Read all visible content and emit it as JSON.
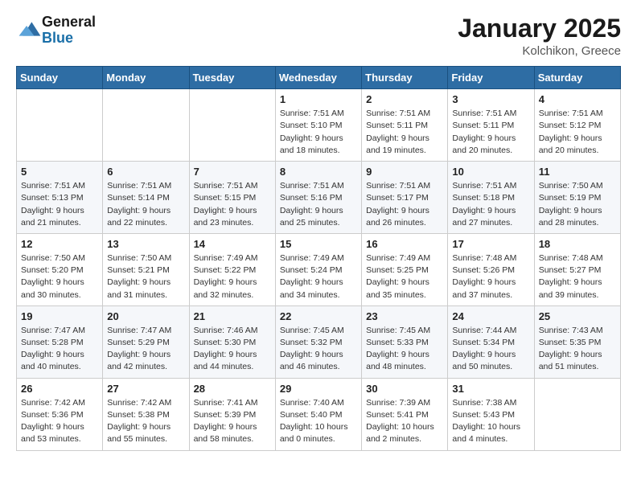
{
  "header": {
    "logo_general": "General",
    "logo_blue": "Blue",
    "month_title": "January 2025",
    "location": "Kolchikon, Greece"
  },
  "weekdays": [
    "Sunday",
    "Monday",
    "Tuesday",
    "Wednesday",
    "Thursday",
    "Friday",
    "Saturday"
  ],
  "weeks": [
    [
      {
        "day": "",
        "info": ""
      },
      {
        "day": "",
        "info": ""
      },
      {
        "day": "",
        "info": ""
      },
      {
        "day": "1",
        "info": "Sunrise: 7:51 AM\nSunset: 5:10 PM\nDaylight: 9 hours\nand 18 minutes."
      },
      {
        "day": "2",
        "info": "Sunrise: 7:51 AM\nSunset: 5:11 PM\nDaylight: 9 hours\nand 19 minutes."
      },
      {
        "day": "3",
        "info": "Sunrise: 7:51 AM\nSunset: 5:11 PM\nDaylight: 9 hours\nand 20 minutes."
      },
      {
        "day": "4",
        "info": "Sunrise: 7:51 AM\nSunset: 5:12 PM\nDaylight: 9 hours\nand 20 minutes."
      }
    ],
    [
      {
        "day": "5",
        "info": "Sunrise: 7:51 AM\nSunset: 5:13 PM\nDaylight: 9 hours\nand 21 minutes."
      },
      {
        "day": "6",
        "info": "Sunrise: 7:51 AM\nSunset: 5:14 PM\nDaylight: 9 hours\nand 22 minutes."
      },
      {
        "day": "7",
        "info": "Sunrise: 7:51 AM\nSunset: 5:15 PM\nDaylight: 9 hours\nand 23 minutes."
      },
      {
        "day": "8",
        "info": "Sunrise: 7:51 AM\nSunset: 5:16 PM\nDaylight: 9 hours\nand 25 minutes."
      },
      {
        "day": "9",
        "info": "Sunrise: 7:51 AM\nSunset: 5:17 PM\nDaylight: 9 hours\nand 26 minutes."
      },
      {
        "day": "10",
        "info": "Sunrise: 7:51 AM\nSunset: 5:18 PM\nDaylight: 9 hours\nand 27 minutes."
      },
      {
        "day": "11",
        "info": "Sunrise: 7:50 AM\nSunset: 5:19 PM\nDaylight: 9 hours\nand 28 minutes."
      }
    ],
    [
      {
        "day": "12",
        "info": "Sunrise: 7:50 AM\nSunset: 5:20 PM\nDaylight: 9 hours\nand 30 minutes."
      },
      {
        "day": "13",
        "info": "Sunrise: 7:50 AM\nSunset: 5:21 PM\nDaylight: 9 hours\nand 31 minutes."
      },
      {
        "day": "14",
        "info": "Sunrise: 7:49 AM\nSunset: 5:22 PM\nDaylight: 9 hours\nand 32 minutes."
      },
      {
        "day": "15",
        "info": "Sunrise: 7:49 AM\nSunset: 5:24 PM\nDaylight: 9 hours\nand 34 minutes."
      },
      {
        "day": "16",
        "info": "Sunrise: 7:49 AM\nSunset: 5:25 PM\nDaylight: 9 hours\nand 35 minutes."
      },
      {
        "day": "17",
        "info": "Sunrise: 7:48 AM\nSunset: 5:26 PM\nDaylight: 9 hours\nand 37 minutes."
      },
      {
        "day": "18",
        "info": "Sunrise: 7:48 AM\nSunset: 5:27 PM\nDaylight: 9 hours\nand 39 minutes."
      }
    ],
    [
      {
        "day": "19",
        "info": "Sunrise: 7:47 AM\nSunset: 5:28 PM\nDaylight: 9 hours\nand 40 minutes."
      },
      {
        "day": "20",
        "info": "Sunrise: 7:47 AM\nSunset: 5:29 PM\nDaylight: 9 hours\nand 42 minutes."
      },
      {
        "day": "21",
        "info": "Sunrise: 7:46 AM\nSunset: 5:30 PM\nDaylight: 9 hours\nand 44 minutes."
      },
      {
        "day": "22",
        "info": "Sunrise: 7:45 AM\nSunset: 5:32 PM\nDaylight: 9 hours\nand 46 minutes."
      },
      {
        "day": "23",
        "info": "Sunrise: 7:45 AM\nSunset: 5:33 PM\nDaylight: 9 hours\nand 48 minutes."
      },
      {
        "day": "24",
        "info": "Sunrise: 7:44 AM\nSunset: 5:34 PM\nDaylight: 9 hours\nand 50 minutes."
      },
      {
        "day": "25",
        "info": "Sunrise: 7:43 AM\nSunset: 5:35 PM\nDaylight: 9 hours\nand 51 minutes."
      }
    ],
    [
      {
        "day": "26",
        "info": "Sunrise: 7:42 AM\nSunset: 5:36 PM\nDaylight: 9 hours\nand 53 minutes."
      },
      {
        "day": "27",
        "info": "Sunrise: 7:42 AM\nSunset: 5:38 PM\nDaylight: 9 hours\nand 55 minutes."
      },
      {
        "day": "28",
        "info": "Sunrise: 7:41 AM\nSunset: 5:39 PM\nDaylight: 9 hours\nand 58 minutes."
      },
      {
        "day": "29",
        "info": "Sunrise: 7:40 AM\nSunset: 5:40 PM\nDaylight: 10 hours\nand 0 minutes."
      },
      {
        "day": "30",
        "info": "Sunrise: 7:39 AM\nSunset: 5:41 PM\nDaylight: 10 hours\nand 2 minutes."
      },
      {
        "day": "31",
        "info": "Sunrise: 7:38 AM\nSunset: 5:43 PM\nDaylight: 10 hours\nand 4 minutes."
      },
      {
        "day": "",
        "info": ""
      }
    ]
  ]
}
